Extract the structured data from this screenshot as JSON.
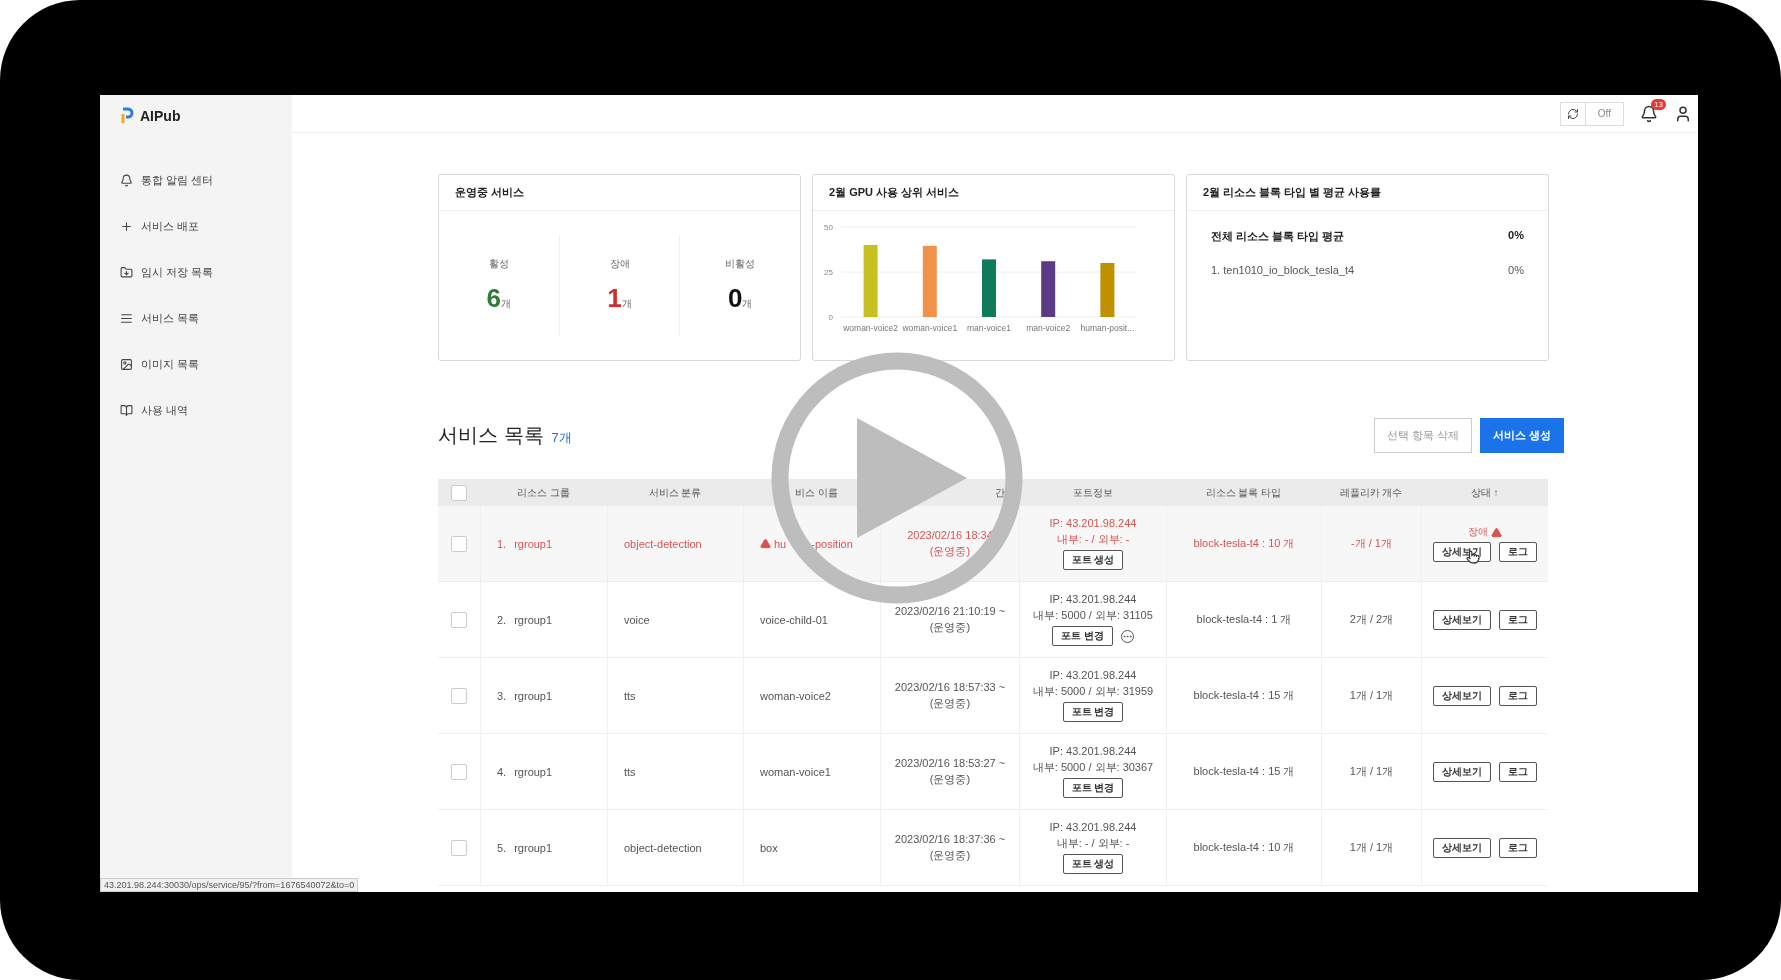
{
  "app": {
    "logo": "AIPub"
  },
  "sidebar": {
    "items": [
      {
        "label": "통합 알림 센터"
      },
      {
        "label": "서비스 배포"
      },
      {
        "label": "임시 저장 목록"
      },
      {
        "label": "서비스 목록"
      },
      {
        "label": "이미지 목록"
      },
      {
        "label": "사용 내역"
      }
    ]
  },
  "topbar": {
    "refresh": {
      "label": "Off",
      "on": false
    },
    "notifications": "13"
  },
  "cards": {
    "running": {
      "title": "운영중 서비스",
      "stats": [
        {
          "label": "활성",
          "value": "6",
          "unit": "개",
          "color": "#2e7d32"
        },
        {
          "label": "장애",
          "value": "1",
          "unit": "개",
          "color": "#d32f2f"
        },
        {
          "label": "비활성",
          "value": "0",
          "unit": "개",
          "color": "#111111"
        }
      ]
    },
    "gpu": {
      "title": "2월 GPU 사용 상위 서비스",
      "chart_data": {
        "type": "bar",
        "categories": [
          "woman-voice2",
          "woman-voice1",
          "man-voice1",
          "man-voice2",
          "human-posit..."
        ],
        "series": [
          {
            "color": "#c6c120",
            "values": [
              40,
              null,
              null,
              null,
              null
            ]
          },
          {
            "color": "#f0924a",
            "values": [
              null,
              39.5,
              null,
              null,
              null
            ]
          },
          {
            "color": "#0f7b5a",
            "values": [
              null,
              null,
              32,
              null,
              null
            ]
          },
          {
            "color": "#5b3a86",
            "values": [
              null,
              null,
              null,
              31,
              null
            ]
          },
          {
            "color": "#bf9000",
            "values": [
              null,
              null,
              null,
              null,
              30
            ]
          }
        ],
        "stacked": true,
        "ylim": [
          0,
          50
        ],
        "yticks": [
          0,
          25,
          50
        ]
      }
    },
    "usage": {
      "title": "2월 리소스 블록 타입 별 평균 사용률",
      "rows": [
        {
          "kind": "total",
          "label": "전체 리소스 블록 타입 평균",
          "value": "0%"
        },
        {
          "kind": "item",
          "label": "1. ten1010_io_block_tesla_t4",
          "value": "0%"
        }
      ]
    }
  },
  "list": {
    "title": "서비스 목록",
    "count": "7개",
    "buttons": [
      {
        "label": "선택 항목 삭제",
        "kind": "secondary"
      },
      {
        "label": "서비스 생성",
        "kind": "primary"
      }
    ]
  },
  "table": {
    "select_all": {
      "checked": false
    },
    "columns": [
      "리소스 그룹",
      "서비스 분류",
      "비스 이름",
      "간",
      "포트정보",
      "리소스 블록 타입",
      "레플리카 개수",
      "상태 ↑"
    ],
    "rows": [
      {
        "checked": false,
        "error": true,
        "number": "1.",
        "group": "rgroup1",
        "category": "object-detection",
        "name": "hu",
        "name_tail": "-position",
        "created": "2023/02/16 18:34",
        "running": "(운영중)",
        "ip": "IP: 43.201.98.244",
        "ports": "내부: - / 외부: -",
        "port_button": "포트 생성",
        "more": false,
        "block": "block-tesla-t4 : 10 개",
        "replicas": "-개 / 1개",
        "status": "장애",
        "actions": [
          "상세보기",
          "로그"
        ]
      },
      {
        "checked": false,
        "error": false,
        "number": "2.",
        "group": "rgroup1",
        "category": "voice",
        "name": "voice-child-01",
        "created": "2023/02/16 21:10:19 ~",
        "running": "(운영중)",
        "ip": "IP: 43.201.98.244",
        "ports": "내부: 5000 / 외부: 31105",
        "port_button": "포트 변경",
        "more": true,
        "block": "block-tesla-t4 : 1 개",
        "replicas": "2개 / 2개",
        "actions": [
          "상세보기",
          "로그"
        ]
      },
      {
        "checked": false,
        "error": false,
        "number": "3.",
        "group": "rgroup1",
        "category": "tts",
        "name": "woman-voice2",
        "created": "2023/02/16 18:57:33 ~",
        "running": "(운영중)",
        "ip": "IP: 43.201.98.244",
        "ports": "내부: 5000 / 외부: 31959",
        "port_button": "포트 변경",
        "more": false,
        "block": "block-tesla-t4 : 15 개",
        "replicas": "1개 / 1개",
        "actions": [
          "상세보기",
          "로그"
        ]
      },
      {
        "checked": false,
        "error": false,
        "number": "4.",
        "group": "rgroup1",
        "category": "tts",
        "name": "woman-voice1",
        "created": "2023/02/16 18:53:27 ~",
        "running": "(운영중)",
        "ip": "IP: 43.201.98.244",
        "ports": "내부: 5000 / 외부: 30367",
        "port_button": "포트 변경",
        "more": false,
        "block": "block-tesla-t4 : 15 개",
        "replicas": "1개 / 1개",
        "actions": [
          "상세보기",
          "로그"
        ]
      },
      {
        "checked": false,
        "error": false,
        "number": "5.",
        "group": "rgroup1",
        "category": "object-detection",
        "name": "box",
        "created": "2023/02/16 18:37:36 ~",
        "running": "(운영중)",
        "ip": "IP: 43.201.98.244",
        "ports": "내부: - / 외부: -",
        "port_button": "포트 생성",
        "more": false,
        "block": "block-tesla-t4 : 10 개",
        "replicas": "1개 / 1개",
        "actions": [
          "상세보기",
          "로그"
        ]
      }
    ]
  },
  "status_bar": "43.201.98.244:30030/ops/service/95/?from=1676540072&to=0",
  "player": {
    "paused": true
  }
}
